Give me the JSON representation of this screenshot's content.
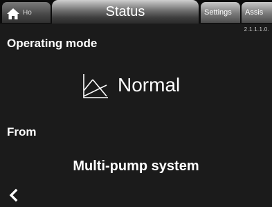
{
  "tabs": {
    "home": {
      "label": "Ho",
      "icon": "home-icon"
    },
    "status": {
      "label": "Status"
    },
    "settings": {
      "label": "Settings"
    },
    "assist": {
      "label": "Assis"
    }
  },
  "menu_id": "2.1.1.1.0.",
  "operating_mode": {
    "heading": "Operating mode",
    "icon": "operating-mode-icon",
    "value": "Normal"
  },
  "source": {
    "heading": "From",
    "value": "Multi-pump system"
  },
  "back": {
    "icon": "chevron-left-icon"
  },
  "colors": {
    "background": "#1b1b1b",
    "tabbar": "#0c0c0c",
    "text": "#ffffff"
  }
}
